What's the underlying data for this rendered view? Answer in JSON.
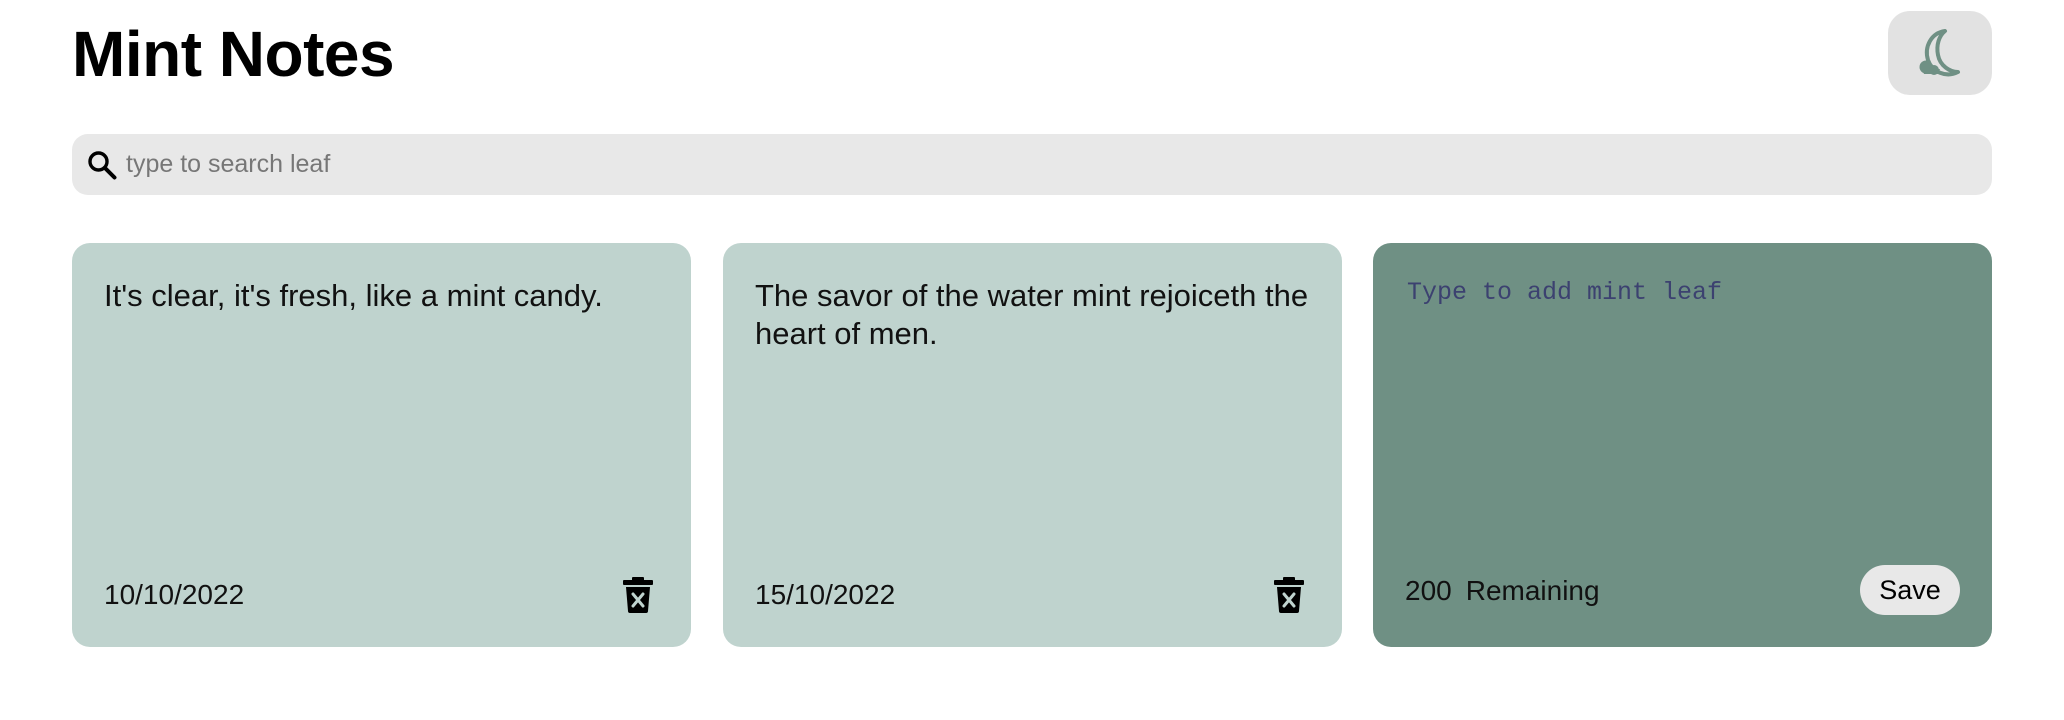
{
  "app": {
    "title": "Mint Notes"
  },
  "theme_toggle": {
    "icon": "moon-icon",
    "icon_color": "#6f9084",
    "bg_color": "#e2e2e2"
  },
  "search": {
    "placeholder": "type to search leaf",
    "value": "",
    "icon": "search-icon"
  },
  "colors": {
    "note_bg": "#bfd3ce",
    "new_note_bg": "#6f9084",
    "search_bg": "#e8e8e8"
  },
  "notes": [
    {
      "text": "It's clear, it's fresh, like a mint candy.",
      "date": "10/10/2022",
      "delete_icon": "trash-icon"
    },
    {
      "text": "The savor of the water mint rejoiceth the heart of men.",
      "date": "15/10/2022",
      "delete_icon": "trash-icon"
    }
  ],
  "new_note": {
    "placeholder": "Type to add mint leaf",
    "value": "",
    "remaining_count": "200",
    "remaining_label": "Remaining",
    "save_label": "Save"
  }
}
